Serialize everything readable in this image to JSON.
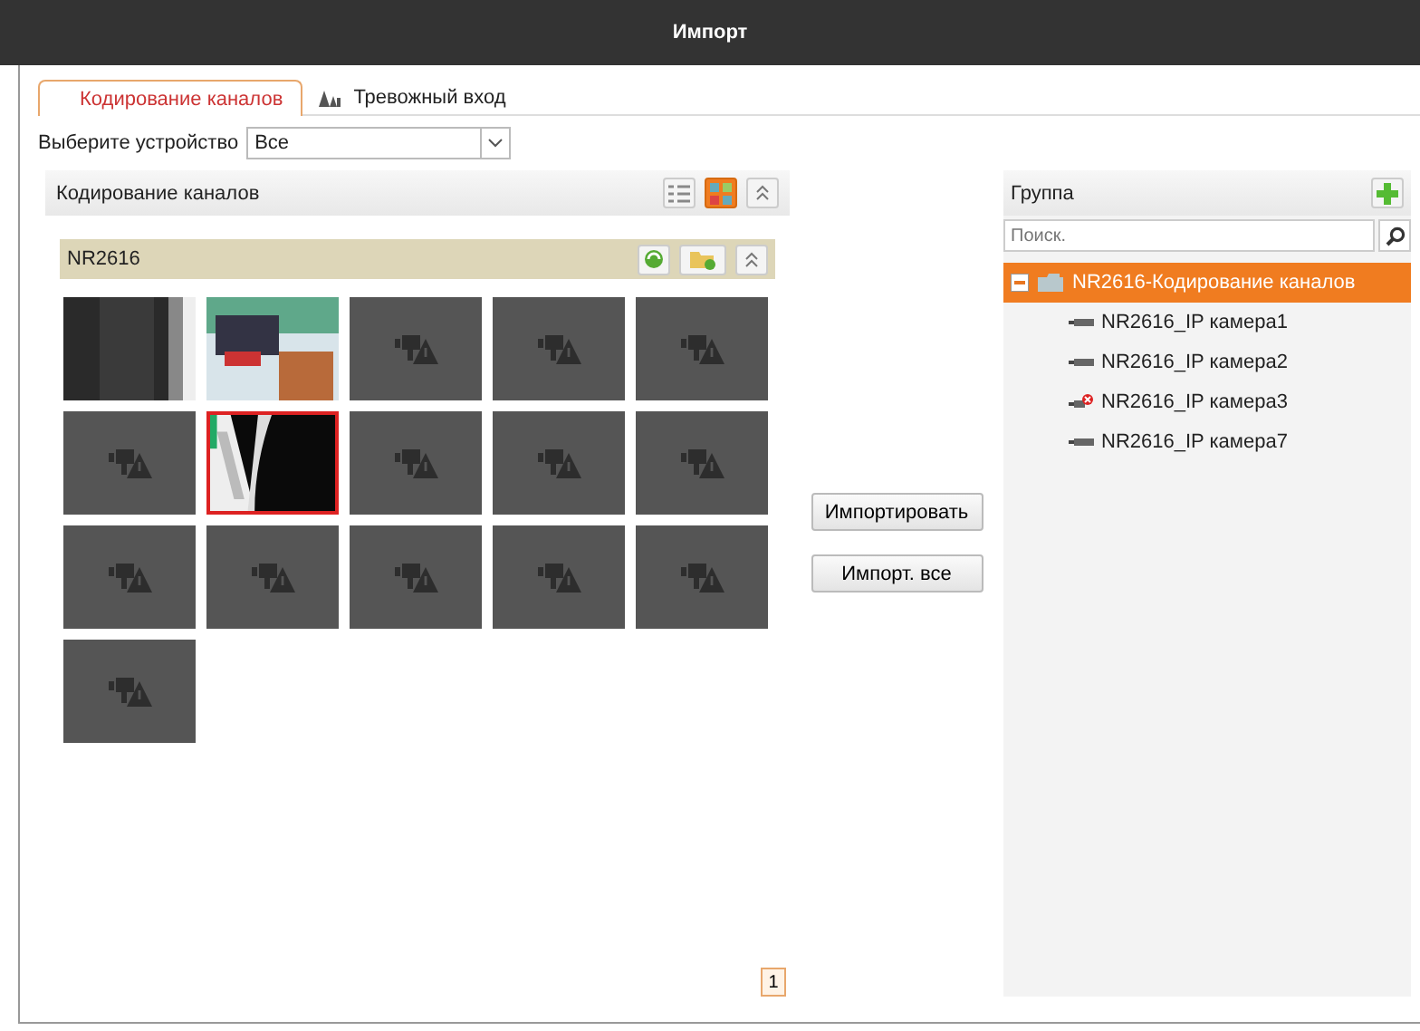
{
  "window": {
    "title": "Импорт"
  },
  "tabs": [
    {
      "label": "Кодирование каналов",
      "selected": true,
      "icon": false
    },
    {
      "label": "Тревожный вход",
      "selected": false,
      "icon": true
    }
  ],
  "device_select": {
    "label": "Выберите устройство",
    "value": "Все"
  },
  "channels_panel": {
    "title": "Кодирование каналов",
    "view_buttons": [
      {
        "kind": "list",
        "selected": false
      },
      {
        "kind": "grid",
        "selected": true
      }
    ],
    "device": "NR2616",
    "tiles": [
      {
        "kind": "video",
        "selected": false
      },
      {
        "kind": "video",
        "selected": false
      },
      {
        "kind": "offline",
        "selected": false
      },
      {
        "kind": "offline",
        "selected": false
      },
      {
        "kind": "offline",
        "selected": false
      },
      {
        "kind": "offline",
        "selected": false
      },
      {
        "kind": "video",
        "selected": true
      },
      {
        "kind": "offline",
        "selected": false
      },
      {
        "kind": "offline",
        "selected": false
      },
      {
        "kind": "offline",
        "selected": false
      },
      {
        "kind": "offline",
        "selected": false
      },
      {
        "kind": "offline",
        "selected": false
      },
      {
        "kind": "offline",
        "selected": false
      },
      {
        "kind": "offline",
        "selected": false
      },
      {
        "kind": "offline",
        "selected": false
      },
      {
        "kind": "offline",
        "selected": false
      }
    ],
    "pages": [
      {
        "label": "1",
        "selected": true
      }
    ]
  },
  "buttons": [
    "Импортировать",
    "Импорт. все"
  ],
  "group_panel": {
    "title": "Группа",
    "search_placeholder": "Поиск.",
    "tree": [
      {
        "label": "NR2616-Кодирование каналов",
        "expanded": true,
        "selected": true,
        "children": [
          {
            "label": "NR2616_IP камера1",
            "error": false
          },
          {
            "label": "NR2616_IP камера2",
            "error": false
          },
          {
            "label": "NR2616_IP камера3",
            "error": true
          },
          {
            "label": "NR2616_IP камера7",
            "error": false
          }
        ]
      }
    ]
  }
}
